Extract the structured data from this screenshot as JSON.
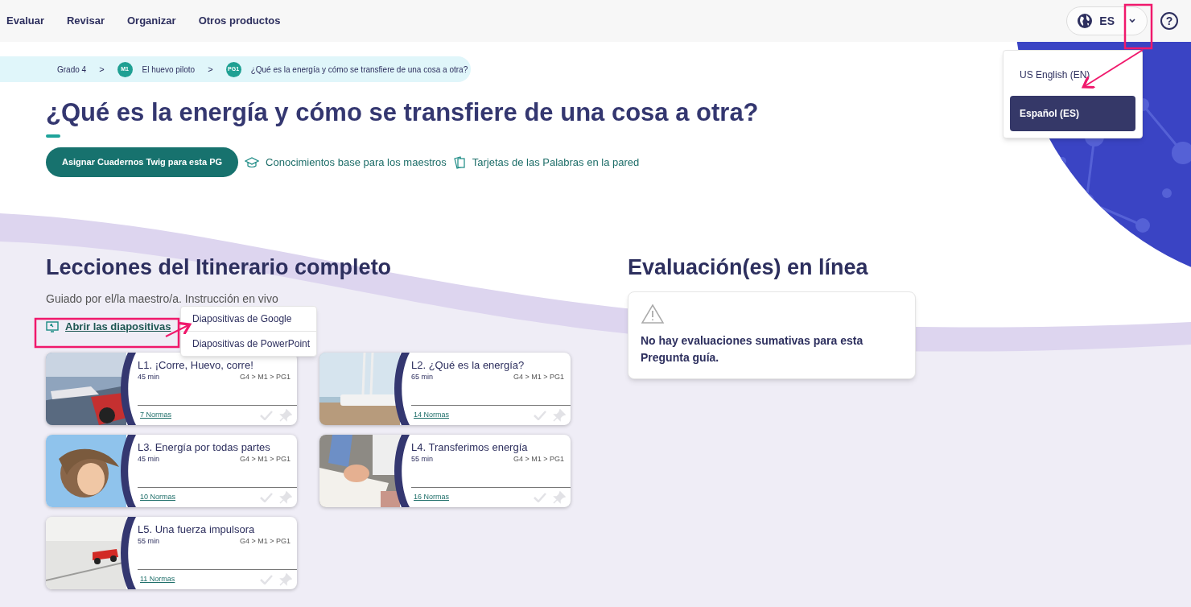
{
  "nav": {
    "items": [
      "Evaluar",
      "Revisar",
      "Organizar",
      "Otros productos"
    ]
  },
  "language": {
    "code": "ES",
    "help": "?",
    "options": [
      {
        "label": "US English (EN)",
        "selected": false
      },
      {
        "label": "Español (ES)",
        "selected": true
      }
    ]
  },
  "breadcrumb": [
    {
      "label": "Grado 4"
    },
    {
      "separator": ">",
      "badge": "M1",
      "label": "El huevo piloto"
    },
    {
      "separator": ">",
      "badge": "PG1",
      "label": "¿Qué es la energía y cómo se transfiere de una cosa a otra?"
    }
  ],
  "title": "¿Qué es la energía y cómo se transfiere de una cosa a otra?",
  "actions": {
    "primary": "Asignar Cuadernos Twig para esta PG",
    "links": [
      {
        "kind": "cap",
        "label": "Conocimientos base para los maestros"
      },
      {
        "kind": "cards",
        "label": "Tarjetas de las Palabras en la pared"
      }
    ]
  },
  "lessons": {
    "heading": "Lecciones del Itinerario completo",
    "subheading": "Guiado por el/la maestro/a. Instrucción en vivo",
    "slides_link": "Abrir las diapositivas",
    "slides_menu": [
      "Diapositivas de Google",
      "Diapositivas de PowerPoint"
    ],
    "cards": [
      {
        "title": "L1. ¡Corre, Huevo, corre!",
        "duration": "45 min",
        "path": "G4 > M1 > PG1",
        "standards": "7 Normas"
      },
      {
        "title": "L2. ¿Qué es la energía?",
        "duration": "65 min",
        "path": "G4 > M1 > PG1",
        "standards": "14 Normas"
      },
      {
        "title": "L3. Energía por todas partes",
        "duration": "45 min",
        "path": "G4 > M1 > PG1",
        "standards": "10 Normas"
      },
      {
        "title": "L4. Transferimos energía",
        "duration": "55 min",
        "path": "G4 > M1 > PG1",
        "standards": "16 Normas"
      },
      {
        "title": "L5. Una fuerza impulsora",
        "duration": "55 min",
        "path": "G4 > M1 > PG1",
        "standards": "11 Normas"
      }
    ]
  },
  "assessments": {
    "heading": "Evaluación(es) en línea",
    "message": "No hay evaluaciones sumativas para esta Pregunta guía."
  }
}
